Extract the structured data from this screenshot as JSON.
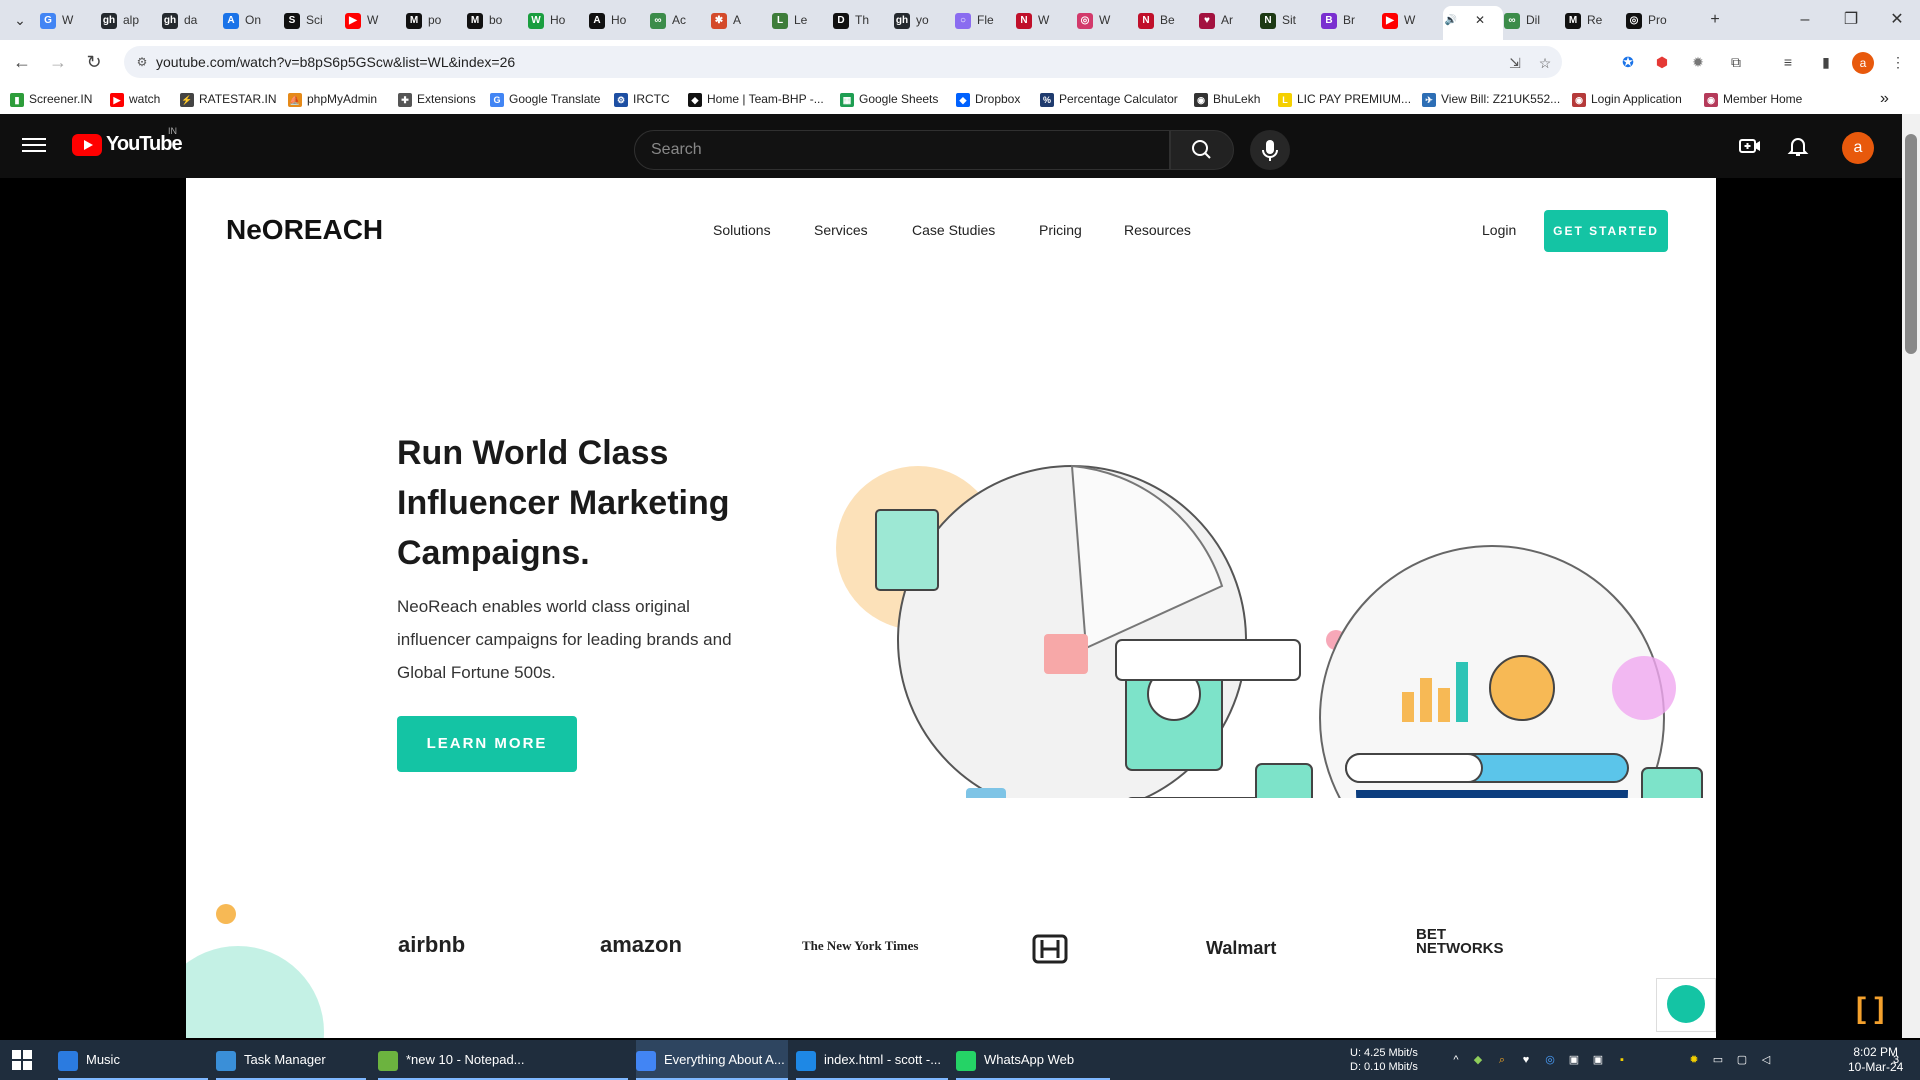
{
  "browser": {
    "tabs": [
      {
        "label": "W",
        "fav": "G",
        "color": "#4285f4"
      },
      {
        "label": "alp",
        "fav": "gh",
        "color": "#24292e"
      },
      {
        "label": "da",
        "fav": "gh",
        "color": "#24292e"
      },
      {
        "label": "On",
        "fav": "A",
        "color": "#1a73e8"
      },
      {
        "label": "Sci",
        "fav": "S",
        "color": "#111111"
      },
      {
        "label": "W",
        "fav": "▶",
        "color": "#ff0000"
      },
      {
        "label": "po",
        "fav": "M",
        "color": "#111111"
      },
      {
        "label": "bo",
        "fav": "M",
        "color": "#111111"
      },
      {
        "label": "Ho",
        "fav": "W",
        "color": "#1a9e3f"
      },
      {
        "label": "Ho",
        "fav": "A",
        "color": "#111111"
      },
      {
        "label": "Ac",
        "fav": "∞",
        "color": "#3c8c4a"
      },
      {
        "label": "A",
        "fav": "✱",
        "color": "#d44a2a"
      },
      {
        "label": "Le",
        "fav": "L",
        "color": "#3e7d3a"
      },
      {
        "label": "Th",
        "fav": "D",
        "color": "#111111"
      },
      {
        "label": "yo",
        "fav": "gh",
        "color": "#24292e"
      },
      {
        "label": "Fle",
        "fav": "○",
        "color": "#8a6cf0"
      },
      {
        "label": "W",
        "fav": "N",
        "color": "#c0102a"
      },
      {
        "label": "W",
        "fav": "◎",
        "color": "#d23a6b"
      },
      {
        "label": "Be",
        "fav": "N",
        "color": "#c0102a"
      },
      {
        "label": "Ar",
        "fav": "♥",
        "color": "#a3123f"
      },
      {
        "label": "Sit",
        "fav": "N",
        "color": "#1d3a14"
      },
      {
        "label": "Br",
        "fav": "B",
        "color": "#7a2fd0"
      },
      {
        "label": "W",
        "fav": "▶",
        "color": "#ff0000"
      },
      {
        "label": "",
        "fav": "🔊",
        "color": "#ffffff"
      },
      {
        "label": "Dil",
        "fav": "∞",
        "color": "#3c8c4a"
      },
      {
        "label": "Re",
        "fav": "M",
        "color": "#111111"
      },
      {
        "label": "Pro",
        "fav": "◎",
        "color": "#111111"
      }
    ],
    "new_tab": "+",
    "minimize": "–",
    "restore": "❐",
    "close": "✕",
    "url": "youtube.com/watch?v=b8pS6p5GScw&list=WL&index=26",
    "bookmarks": [
      {
        "label": "Screener.IN",
        "color": "#2d9d3a",
        "fav": "▮"
      },
      {
        "label": "watch",
        "color": "#ff0000",
        "fav": "▶"
      },
      {
        "label": "RATESTAR.IN",
        "color": "#444444",
        "fav": "⚡"
      },
      {
        "label": "phpMyAdmin",
        "color": "#e58a19",
        "fav": "⛵"
      },
      {
        "label": "Extensions",
        "color": "#555555",
        "fav": "✚"
      },
      {
        "label": "Google Translate",
        "color": "#4285f4",
        "fav": "G"
      },
      {
        "label": "IRCTC",
        "color": "#1d4fa3",
        "fav": "⚙"
      },
      {
        "label": "Home | Team-BHP -...",
        "color": "#111111",
        "fav": "◆"
      },
      {
        "label": "Google Sheets",
        "color": "#1e9e52",
        "fav": "▦"
      },
      {
        "label": "Dropbox",
        "color": "#0061fe",
        "fav": "◆"
      },
      {
        "label": "Percentage Calculator",
        "color": "#1f3b6e",
        "fav": "%"
      },
      {
        "label": "BhuLekh",
        "color": "#333333",
        "fav": "◉"
      },
      {
        "label": "LIC PAY PREMIUM...",
        "color": "#f5d000",
        "fav": "L"
      },
      {
        "label": "View Bill: Z21UK552...",
        "color": "#2d6eb5",
        "fav": "✈"
      },
      {
        "label": "Login Application",
        "color": "#b53a3a",
        "fav": "◉"
      },
      {
        "label": "Member Home",
        "color": "#b53a5a",
        "fav": "◉"
      }
    ],
    "more_bookmarks": "»"
  },
  "youtube": {
    "wordmark": "YouTube",
    "country": "IN",
    "search_placeholder": "Search",
    "avatar_letter": "a"
  },
  "video": {
    "logo": "NeOREACH",
    "nav": [
      "Solutions",
      "Services",
      "Case Studies",
      "Pricing",
      "Resources"
    ],
    "login": "Login",
    "cta": "GET STARTED",
    "hero_title": "Run World Class Influencer Marketing Campaigns.",
    "hero_text": "NeoReach enables world class original influencer campaigns for leading brands and Global Fortune 500s.",
    "learn_more": "LEARN MORE",
    "brands": [
      "airbnb",
      "amazon",
      "The New York Times",
      "Walmart",
      "BET NETWORKS"
    ]
  },
  "taskbar": {
    "apps": [
      {
        "label": "Music",
        "color": "#2b7be0"
      },
      {
        "label": "Task Manager",
        "color": "#3a8fd8"
      },
      {
        "label": "*new 10 - Notepad...",
        "color": "#6cb33f"
      },
      {
        "label": "Everything About A...",
        "color": "#4285f4",
        "active": true
      },
      {
        "label": "index.html - scott -...",
        "color": "#1e88e5"
      },
      {
        "label": "WhatsApp Web",
        "color": "#25d366"
      }
    ],
    "net_up": "U:   4.25 Mbit/s",
    "net_down": "D:   0.10 Mbit/s",
    "time": "8:02 PM",
    "date": "10-Mar-24",
    "notif_count": "3"
  },
  "colors": {
    "accent": "#14c4a4",
    "yt_red": "#ff0000"
  }
}
